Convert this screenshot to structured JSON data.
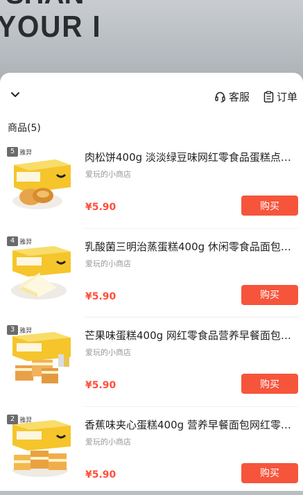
{
  "background": {
    "line1": "SHAN",
    "line2": "YOUR I"
  },
  "header": {
    "collapse_icon": "chevron-down-icon",
    "service_label": "客服",
    "orders_label": "订单"
  },
  "products_title": "商品(5)",
  "products": [
    {
      "rank": "5",
      "brand": "雅羿",
      "title": "肉松饼400g 淡淡绿豆味网红零食品蛋糕点心...",
      "shop": "爱玩的小商店",
      "price": "¥5.90",
      "buy_label": "购买"
    },
    {
      "rank": "4",
      "brand": "雅羿",
      "title": "乳酸菌三明治蒸蛋糕400g 休闲零食品面包点心",
      "shop": "爱玩的小商店",
      "price": "¥5.90",
      "buy_label": "购买"
    },
    {
      "rank": "3",
      "brand": "雅羿",
      "title": "芒果味蛋糕400g 网红零食品营养早餐面包办...",
      "shop": "爱玩的小商店",
      "price": "¥5.90",
      "buy_label": "购买"
    },
    {
      "rank": "2",
      "brand": "雅羿",
      "title": "香蕉味夹心蛋糕400g 营养早餐面包网红零食...",
      "shop": "爱玩的小商店",
      "price": "¥5.90",
      "buy_label": "购买"
    }
  ],
  "colors": {
    "accent": "#f6553c",
    "price": "#ff4f3a",
    "box_yellow": "#f5c52b"
  }
}
